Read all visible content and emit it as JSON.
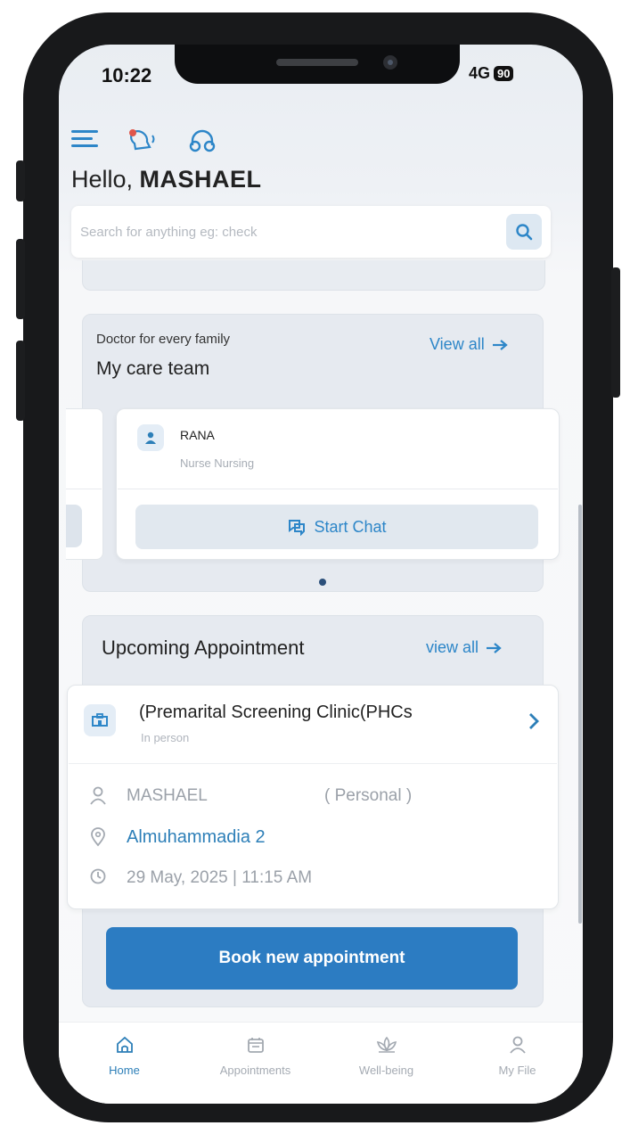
{
  "status_bar": {
    "time": "10:22",
    "network": "4G",
    "battery": "90"
  },
  "greeting": {
    "prefix": "Hello,",
    "name": "MASHAEL"
  },
  "search": {
    "placeholder": "Search for anything eg: check"
  },
  "care_team": {
    "subtitle": "Doctor for every family",
    "title": "My care team",
    "view_all": "View all",
    "doctor": {
      "name": "RANA",
      "role": "Nurse  Nursing"
    },
    "chat_button": "Start Chat"
  },
  "appointment": {
    "title": "Upcoming Appointment",
    "view_all": "view all",
    "clinic": "(Premarital Screening Clinic(PHCs",
    "type": "In person",
    "patient": "MASHAEL",
    "relation": "( Personal )",
    "location": "Almuhammadia 2",
    "datetime": "29 May, 2025 | 11:15 AM"
  },
  "book_button": "Book new appointment",
  "bottom_nav": [
    {
      "label": "Home",
      "icon": "home-icon",
      "active": true
    },
    {
      "label": "Appointments",
      "icon": "calendar-icon",
      "active": false
    },
    {
      "label": "Well-being",
      "icon": "lotus-icon",
      "active": false
    },
    {
      "label": "My File",
      "icon": "user-icon",
      "active": false
    }
  ],
  "colors": {
    "accent": "#2d86c8",
    "primary_button": "#2c7cc2",
    "link": "#2d7fb8"
  }
}
